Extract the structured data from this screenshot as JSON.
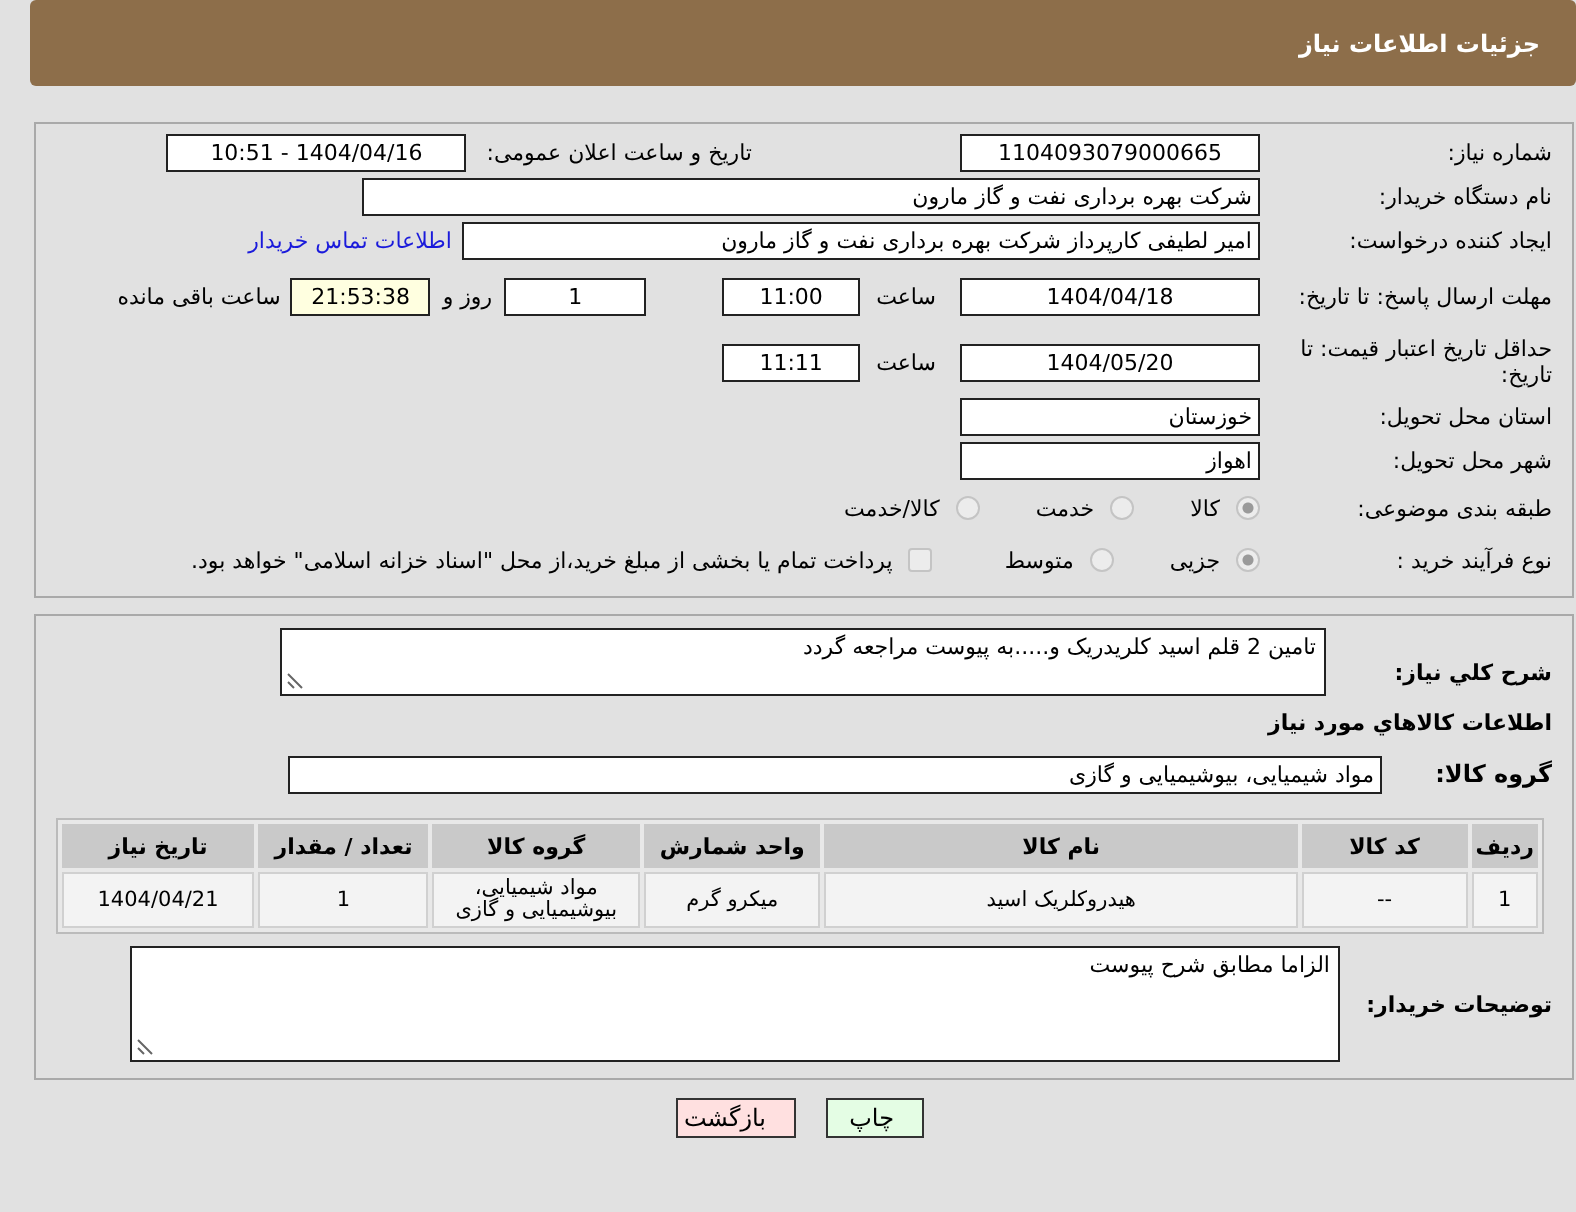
{
  "header": {
    "title": "جزئیات اطلاعات نیاز"
  },
  "details": {
    "need_number": {
      "label": "شماره نیاز:",
      "value": "1104093079000665"
    },
    "announce": {
      "label": "تاریخ و ساعت اعلان عمومی:",
      "value": "1404/04/16 - 10:51"
    },
    "buyer_org": {
      "label": "نام دستگاه خریدار:",
      "value": "شرکت بهره برداری نفت و گاز مارون"
    },
    "creator": {
      "label": "ایجاد کننده درخواست:",
      "value": "امیر لطیفی کارپرداز شرکت بهره برداری نفت و گاز مارون",
      "link": "اطلاعات تماس خریدار"
    },
    "deadline": {
      "label": "مهلت ارسال پاسخ: تا تاریخ:",
      "date": "1404/04/18",
      "time_label": "ساعت",
      "time": "11:00",
      "days": "1",
      "days_label": "روز و",
      "remaining": "21:53:38",
      "remaining_label": "ساعت باقی مانده"
    },
    "price_validity": {
      "label": "حداقل تاریخ اعتبار قیمت: تا تاریخ:",
      "date": "1404/05/20",
      "time_label": "ساعت",
      "time": "11:11"
    },
    "province": {
      "label": "استان محل تحویل:",
      "value": "خوزستان"
    },
    "city": {
      "label": "شهر محل تحویل:",
      "value": "اهواز"
    },
    "category": {
      "label": "طبقه بندی موضوعی:",
      "options": [
        {
          "label": "کالا",
          "selected": true
        },
        {
          "label": "خدمت",
          "selected": false
        },
        {
          "label": "کالا/خدمت",
          "selected": false
        }
      ]
    },
    "process": {
      "label": "نوع فرآیند خرید :",
      "options": [
        {
          "label": "جزیی",
          "selected": true
        },
        {
          "label": "متوسط",
          "selected": false
        }
      ],
      "payment": {
        "label": "پرداخت تمام یا بخشی از مبلغ خرید،از محل \"اسناد خزانه اسلامی\" خواهد بود.",
        "checked": false
      }
    }
  },
  "need": {
    "description_label": "شرح کلي نياز:",
    "description": "تامین 2 قلم اسید کلریدریک و.....به  پیوست مراجعه گردد",
    "goods_title": "اطلاعات كالاهاي مورد نياز",
    "group_label": "گروه کالا:",
    "group": "مواد شیمیایی، بیوشیمیایی و  گازی",
    "table": {
      "columns": [
        "ردیف",
        "کد کالا",
        "نام کالا",
        "واحد شمارش",
        "گروه کالا",
        "تعداد / مقدار",
        "تاریخ نیاز"
      ],
      "rows": [
        [
          "1",
          "--",
          "هیدروکلریک اسید",
          "میکرو گرم",
          "مواد شیمیایی، بیوشیمیایی و گازی",
          "1",
          "1404/04/21"
        ]
      ]
    },
    "buyer_notes_label": "توضیحات خریدار:",
    "buyer_notes": "الزاما مطابق شرح پیوست"
  },
  "buttons": [
    {
      "label": "چاپ",
      "kind": "print"
    },
    {
      "label": "بازگشت",
      "kind": "back"
    }
  ]
}
